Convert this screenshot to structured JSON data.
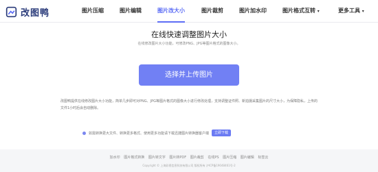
{
  "header": {
    "logo_text": "改图鸭",
    "nav": [
      {
        "label": "图片压缩",
        "active": false
      },
      {
        "label": "图片编辑",
        "active": false
      },
      {
        "label": "图片改大小",
        "active": true
      },
      {
        "label": "图片裁剪",
        "active": false
      },
      {
        "label": "图片加水印",
        "active": false
      },
      {
        "label": "图片格式互转",
        "active": false
      },
      {
        "label": "更多工具",
        "active": false
      }
    ]
  },
  "main": {
    "title": "在线快速调整图片大小",
    "subtitle": "在线修改图片大小功能，可修改PNG、JPG等图片格式的图像大小。",
    "upload_label": "选择并上传图片",
    "description": "改图鸭提供在线修改图片大小功能，简单几步即可对PNG、JPG等图片格式的图像大小进行修改处理，支持调整证件照、新拍摄采集图片的尺寸大小，为保障隐私，上传的文件1小时后会自动删除。",
    "notice_text": "如需转换更大文件、转换更多格式、使用更多功能请下载迅捷图片转换器客户端",
    "download_label": "立即下载"
  },
  "footer": {
    "links": [
      "加水印",
      "图片格式转换",
      "图片转文字",
      "图片转PDF",
      "图片裁剪",
      "在线PS",
      "图片压缩",
      "图片编辑",
      "标签云"
    ],
    "copyright": "Copyright © 上海彩视信息科技有限公司 版权所有 沪ICP备19048461号-2"
  },
  "colors": {
    "accent": "#5b6cf5",
    "button": "#7180f4",
    "logo": "#2a3b7a"
  }
}
